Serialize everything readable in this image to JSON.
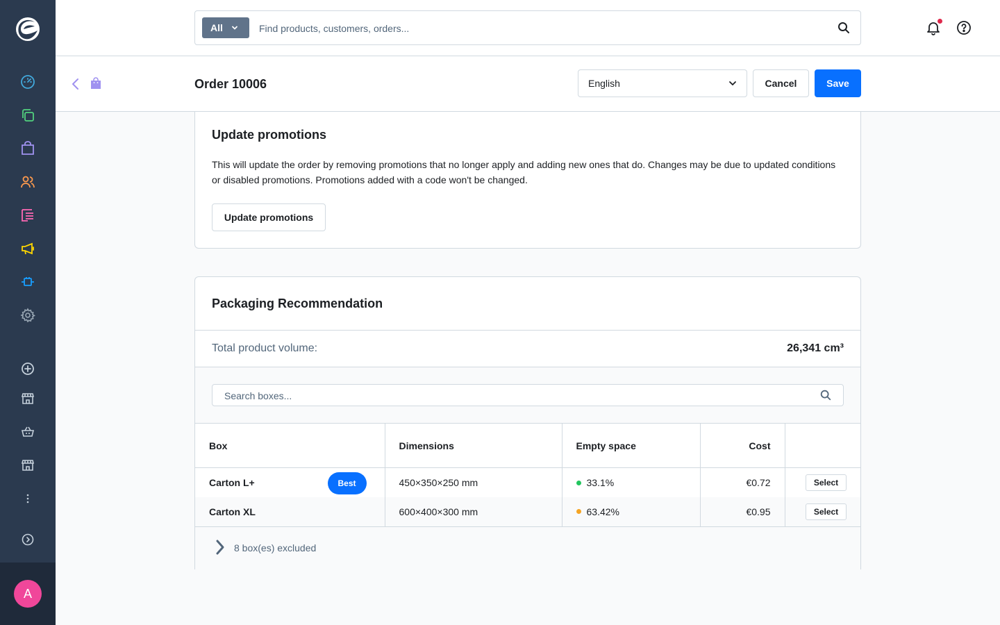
{
  "avatar": {
    "initial": "A"
  },
  "search": {
    "type_label": "All",
    "placeholder": "Find products, customers, orders..."
  },
  "header": {
    "title": "Order 10006",
    "language": "English",
    "cancel_label": "Cancel",
    "save_label": "Save"
  },
  "promotions": {
    "title": "Update promotions",
    "description": "This will update the order by removing promotions that no longer apply and adding new ones that do. Changes may be due to updated conditions or disabled promotions. Promotions added with a code won't be changed.",
    "button_label": "Update promotions"
  },
  "packaging": {
    "title": "Packaging Recommendation",
    "volume_label": "Total product volume:",
    "volume_value": "26,341 cm³",
    "search_placeholder": "Search boxes...",
    "columns": [
      "Box",
      "Dimensions",
      "Empty space",
      "Cost",
      ""
    ],
    "rows": [
      {
        "box": "Carton L+",
        "badge": "Best",
        "dimensions": "450×350×250 mm",
        "empty_space": "33.1%",
        "empty_color": "#22c55e",
        "cost": "€0.72",
        "select_label": "Select"
      },
      {
        "box": "Carton XL",
        "badge": "",
        "dimensions": "600×400×300 mm",
        "empty_space": "63.42%",
        "empty_color": "#f5a524",
        "cost": "€0.95",
        "select_label": "Select"
      }
    ],
    "excluded_label": "8 box(es) excluded"
  },
  "colors": {
    "sidebar": "#2b3a4f",
    "primary": "#0870ff",
    "avatar": "#f0479a",
    "notification": "#de294c"
  },
  "icons": {
    "sidebar_nav": [
      "dashboard-icon",
      "catalogues-icon",
      "orders-icon",
      "customers-icon",
      "content-icon",
      "marketing-icon",
      "extensions-icon",
      "settings-icon"
    ],
    "sidebar_sales": [
      "add-channel-icon",
      "storefront-icon",
      "basket-icon",
      "storefront-2-icon",
      "more-icon",
      "expand-icon"
    ]
  }
}
